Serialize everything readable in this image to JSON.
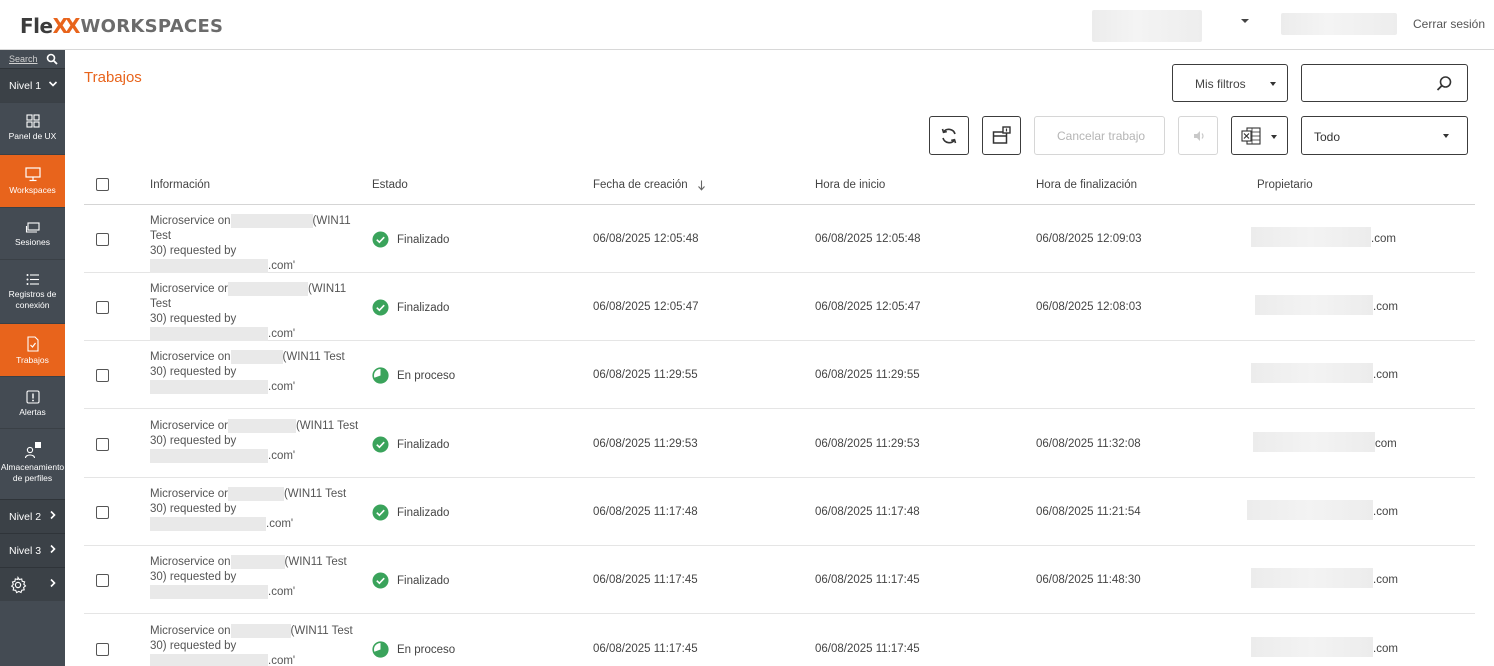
{
  "header": {
    "logo_flex": "Fle",
    "logo_xx": "XX",
    "logo_ws": "WORKSPACES",
    "logout": "Cerrar sesión"
  },
  "sidebar": {
    "search_label": "Search",
    "level1": "Nivel 1",
    "items": [
      {
        "label": "Panel de UX",
        "icon": "grid-icon"
      },
      {
        "label": "Workspaces",
        "icon": "monitor-icon",
        "active": true
      },
      {
        "label": "Sesiones",
        "icon": "sessions-icon"
      },
      {
        "label": "Registros de conexión",
        "icon": "list-icon"
      },
      {
        "label": "Trabajos",
        "icon": "job-icon",
        "active": true
      },
      {
        "label": "Alertas",
        "icon": "alert-icon"
      },
      {
        "label": "Almacenamiento de perfiles",
        "icon": "profile-storage-icon"
      }
    ],
    "level2": "Nivel 2",
    "level3": "Nivel 3"
  },
  "main": {
    "title": "Trabajos",
    "filters_label": "Mis filtros",
    "search_value": "",
    "cancel_job": "Cancelar trabajo",
    "scope_select": "Todo"
  },
  "table": {
    "columns": [
      "Información",
      "Estado",
      "Fecha de creación",
      "Hora de inicio",
      "Hora de finalización",
      "Propietario"
    ],
    "sort_column": "Fecha de creación",
    "sort_direction": "desc",
    "rows": [
      {
        "info1": "Microservice on",
        "info2": "(WIN11 Test",
        "info3": "30) requested by",
        "info4": ".com'",
        "status": "Finalizado",
        "created": "06/08/2025 12:05:48",
        "start": "06/08/2025 12:05:48",
        "end": "06/08/2025 12:09:03",
        "owner_suffix": ".com"
      },
      {
        "info1": "Microservice or",
        "info2": "(WIN11 Test",
        "info3": "30) requested by",
        "info4": ".com'",
        "status": "Finalizado",
        "created": "06/08/2025 12:05:47",
        "start": "06/08/2025 12:05:47",
        "end": "06/08/2025 12:08:03",
        "owner_suffix": ".com"
      },
      {
        "info1": "Microservice on",
        "info2": "(WIN11 Test",
        "info3": "30) requested by",
        "info4": ".com'",
        "status": "En proceso",
        "created": "06/08/2025 11:29:55",
        "start": "06/08/2025 11:29:55",
        "end": "",
        "owner_suffix": ".com"
      },
      {
        "info1": "Microservice or",
        "info2": "(WIN11 Test",
        "info3": "30) requested by",
        "info4": ".com'",
        "status": "Finalizado",
        "created": "06/08/2025 11:29:53",
        "start": "06/08/2025 11:29:53",
        "end": "06/08/2025 11:32:08",
        "owner_suffix": "com"
      },
      {
        "info1": "Microservice or",
        "info2": "(WIN11 Test",
        "info3": "30) requested by",
        "info4": ".com'",
        "status": "Finalizado",
        "created": "06/08/2025 11:17:48",
        "start": "06/08/2025 11:17:48",
        "end": "06/08/2025 11:21:54",
        "owner_suffix": ".com"
      },
      {
        "info1": "Microservice on",
        "info2": "(WIN11 Test",
        "info3": "30) requested by",
        "info4": ".com'",
        "status": "Finalizado",
        "created": "06/08/2025 11:17:45",
        "start": "06/08/2025 11:17:45",
        "end": "06/08/2025 11:48:30",
        "owner_suffix": ".com"
      },
      {
        "info1": "Microservice on",
        "info2": "(WIN11 Test",
        "info3": "30) requested by",
        "info4": ".com'",
        "status": "En proceso",
        "created": "06/08/2025 11:17:45",
        "start": "06/08/2025 11:17:45",
        "end": "",
        "owner_suffix": ".com"
      }
    ]
  },
  "colors": {
    "accent": "#e8641c",
    "sidebar_bg": "#444b53",
    "success": "#3aa35b"
  }
}
